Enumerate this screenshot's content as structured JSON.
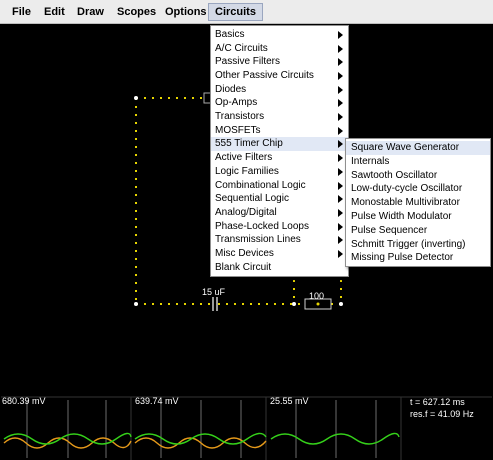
{
  "menubar": {
    "items": [
      "File",
      "Edit",
      "Draw",
      "Scopes",
      "Options",
      "Circuits"
    ],
    "active": "Circuits"
  },
  "circuits_menu": {
    "items": [
      {
        "label": "Basics",
        "submenu": true
      },
      {
        "label": "A/C Circuits",
        "submenu": true
      },
      {
        "label": "Passive Filters",
        "submenu": true
      },
      {
        "label": "Other Passive Circuits",
        "submenu": true
      },
      {
        "label": "Diodes",
        "submenu": true
      },
      {
        "label": "Op-Amps",
        "submenu": true
      },
      {
        "label": "Transistors",
        "submenu": true
      },
      {
        "label": "MOSFETs",
        "submenu": true
      },
      {
        "label": "555 Timer Chip",
        "submenu": true
      },
      {
        "label": "Active Filters",
        "submenu": true
      },
      {
        "label": "Logic Families",
        "submenu": true
      },
      {
        "label": "Combinational Logic",
        "submenu": true
      },
      {
        "label": "Sequential Logic",
        "submenu": true
      },
      {
        "label": "Analog/Digital",
        "submenu": true
      },
      {
        "label": "Phase-Locked Loops",
        "submenu": true
      },
      {
        "label": "Transmission Lines",
        "submenu": true
      },
      {
        "label": "Misc Devices",
        "submenu": true
      },
      {
        "label": "Blank Circuit",
        "submenu": false
      }
    ],
    "highlighted": "555 Timer Chip"
  },
  "timer_submenu": {
    "items": [
      "Square Wave Generator",
      "Internals",
      "Sawtooth Oscillator",
      "Low-duty-cycle Oscillator",
      "Monostable Multivibrator",
      "Pulse Width Modulator",
      "Pulse Sequencer",
      "Schmitt Trigger (inverting)",
      "Missing Pulse Detector"
    ],
    "highlighted": "Square Wave Generator"
  },
  "circuit": {
    "capacitor_label": "15 uF",
    "resistor_label": "100"
  },
  "scopes": {
    "panels": [
      {
        "value": "680.39 mV"
      },
      {
        "value": "639.74 mV"
      },
      {
        "value": "25.55 mV"
      }
    ],
    "time": "t = 627.12 ms",
    "res_freq": "res.f = 41.09 Hz"
  },
  "colors": {
    "wire": "#e6d400",
    "wire_dot": "#ffffff",
    "scope_green": "#35d11a",
    "scope_orange": "#e69a1a",
    "menu_highlight": "#e1e8f5"
  }
}
